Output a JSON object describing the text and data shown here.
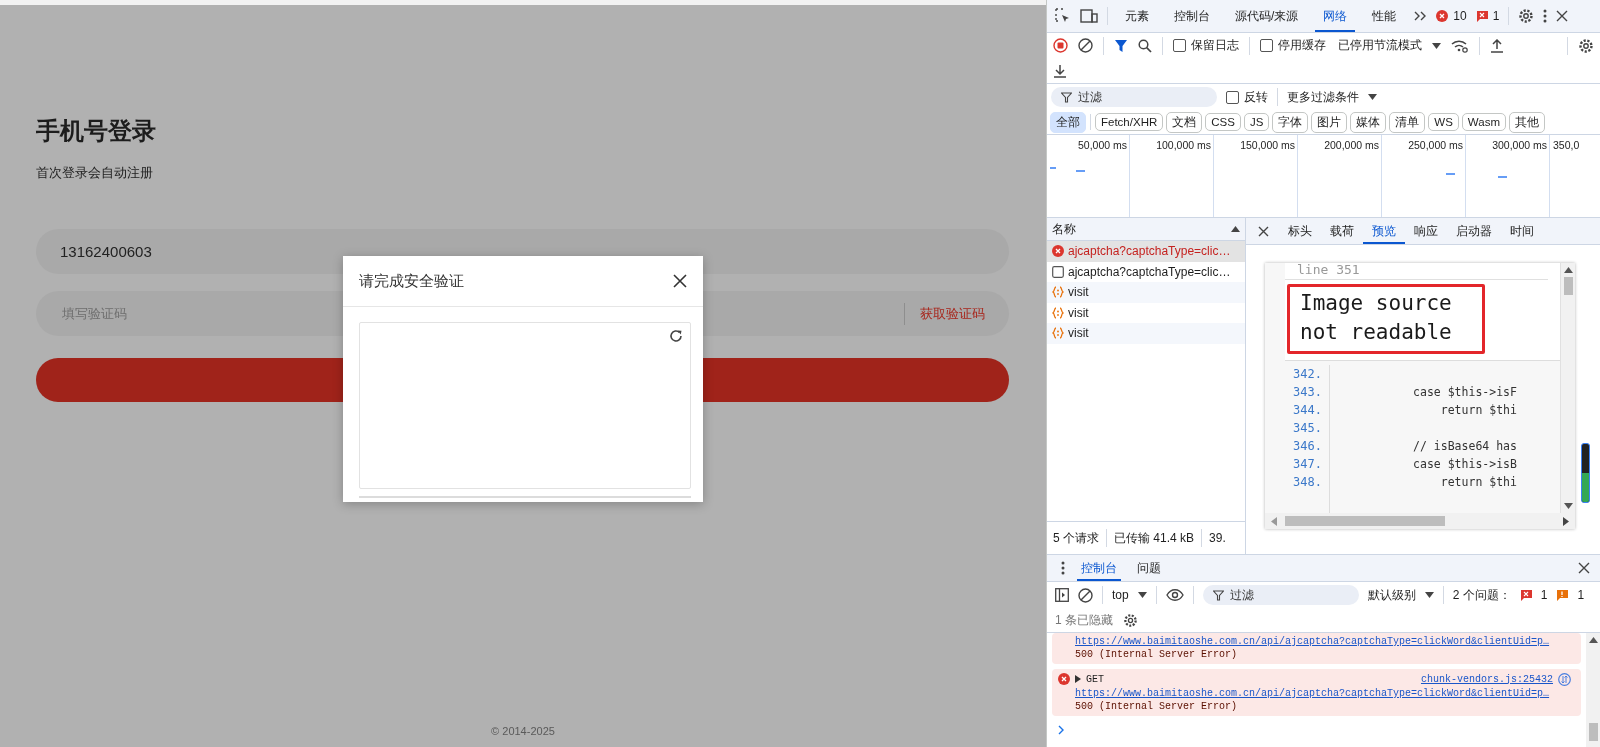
{
  "login": {
    "title": "手机号登录",
    "subtitle": "首次登录会自动注册",
    "phone": {
      "value": "13162400603"
    },
    "code": {
      "placeholder": "填写验证码"
    },
    "get_code": "获取验证码",
    "footer": "© 2014-2025"
  },
  "dialog": {
    "title": "请完成安全验证"
  },
  "devtools": {
    "tabs": [
      {
        "label": "元素",
        "selected": false
      },
      {
        "label": "控制台",
        "selected": false
      },
      {
        "label": "源代码/来源",
        "selected": false
      },
      {
        "label": "网络",
        "selected": true
      },
      {
        "label": "性能",
        "selected": false
      }
    ],
    "error_count": "10",
    "issue_count": "1",
    "network": {
      "preserve_log": {
        "label": "保留日志",
        "checked": false
      },
      "disable_cache": {
        "label": "停用缓存",
        "checked": false
      },
      "throttling": "已停用节流模式",
      "filter": {
        "placeholder": "过滤"
      },
      "invert": {
        "label": "反转",
        "checked": false
      },
      "more_filters": "更多过滤条件",
      "types": [
        {
          "label": "全部",
          "selected": true
        },
        {
          "label": "Fetch/XHR",
          "selected": false
        },
        {
          "label": "文档",
          "selected": false
        },
        {
          "label": "CSS",
          "selected": false
        },
        {
          "label": "JS",
          "selected": false
        },
        {
          "label": "字体",
          "selected": false
        },
        {
          "label": "图片",
          "selected": false
        },
        {
          "label": "媒体",
          "selected": false
        },
        {
          "label": "清单",
          "selected": false
        },
        {
          "label": "WS",
          "selected": false
        },
        {
          "label": "Wasm",
          "selected": false
        },
        {
          "label": "其他",
          "selected": false
        }
      ],
      "timeline_ticks": [
        "50,000 ms",
        "100,000 ms",
        "150,000 ms",
        "200,000 ms",
        "250,000 ms",
        "300,000 ms",
        "350,0"
      ],
      "name_header": "名称",
      "requests": [
        {
          "name": "ajcaptcha?captchaType=clic…",
          "kind": "error",
          "selected": true
        },
        {
          "name": "ajcaptcha?captchaType=clic…",
          "kind": "image",
          "selected": false
        },
        {
          "name": "visit",
          "kind": "json",
          "selected": false
        },
        {
          "name": "visit",
          "kind": "json",
          "selected": false
        },
        {
          "name": "visit",
          "kind": "json",
          "selected": false
        }
      ],
      "detail_tabs": [
        {
          "label": "标头",
          "selected": false
        },
        {
          "label": "载荷",
          "selected": false
        },
        {
          "label": "预览",
          "selected": true
        },
        {
          "label": "响应",
          "selected": false
        },
        {
          "label": "启动器",
          "selected": false
        },
        {
          "label": "时间",
          "selected": false
        }
      ],
      "preview": {
        "line_label": "line 351",
        "message": "Image source not readable",
        "code_lines": [
          {
            "number": "342."
          },
          {
            "number": "343.",
            "code": "            case $this->isF"
          },
          {
            "number": "344.",
            "code": "                return $thi"
          },
          {
            "number": "345."
          },
          {
            "number": "346.",
            "code": "            // isBase64 has"
          },
          {
            "number": "347.",
            "code": "            case $this->isB"
          },
          {
            "number": "348.",
            "code": "                return $thi"
          }
        ]
      },
      "summary": [
        "5 个请求",
        "已传输 41.4 kB",
        "39."
      ]
    },
    "drawer": {
      "tabs": [
        {
          "label": "控制台",
          "selected": true
        },
        {
          "label": "问题",
          "selected": false
        }
      ],
      "context": "top",
      "filter": {
        "placeholder": "过滤"
      },
      "log_level": "默认级别",
      "issues_label": "2 个问题：",
      "issue_errors": "1",
      "issue_warnings": "1",
      "hidden_note": "1 条已隐藏",
      "messages": [
        {
          "kind": "error",
          "url": "https://www.baimitaoshe.com.cn/api/ajcaptcha?captchaType=clickWord&clientUid=p…",
          "status": "500 (Internal Server Error)"
        },
        {
          "kind": "error",
          "method": "GET",
          "source": "chunk-vendors.js:25432",
          "url": "https://www.baimitaoshe.com.cn/api/ajcaptcha?captchaType=clickWord&clientUid=p…",
          "status": "500 (Internal Server Error)"
        }
      ]
    }
  }
}
